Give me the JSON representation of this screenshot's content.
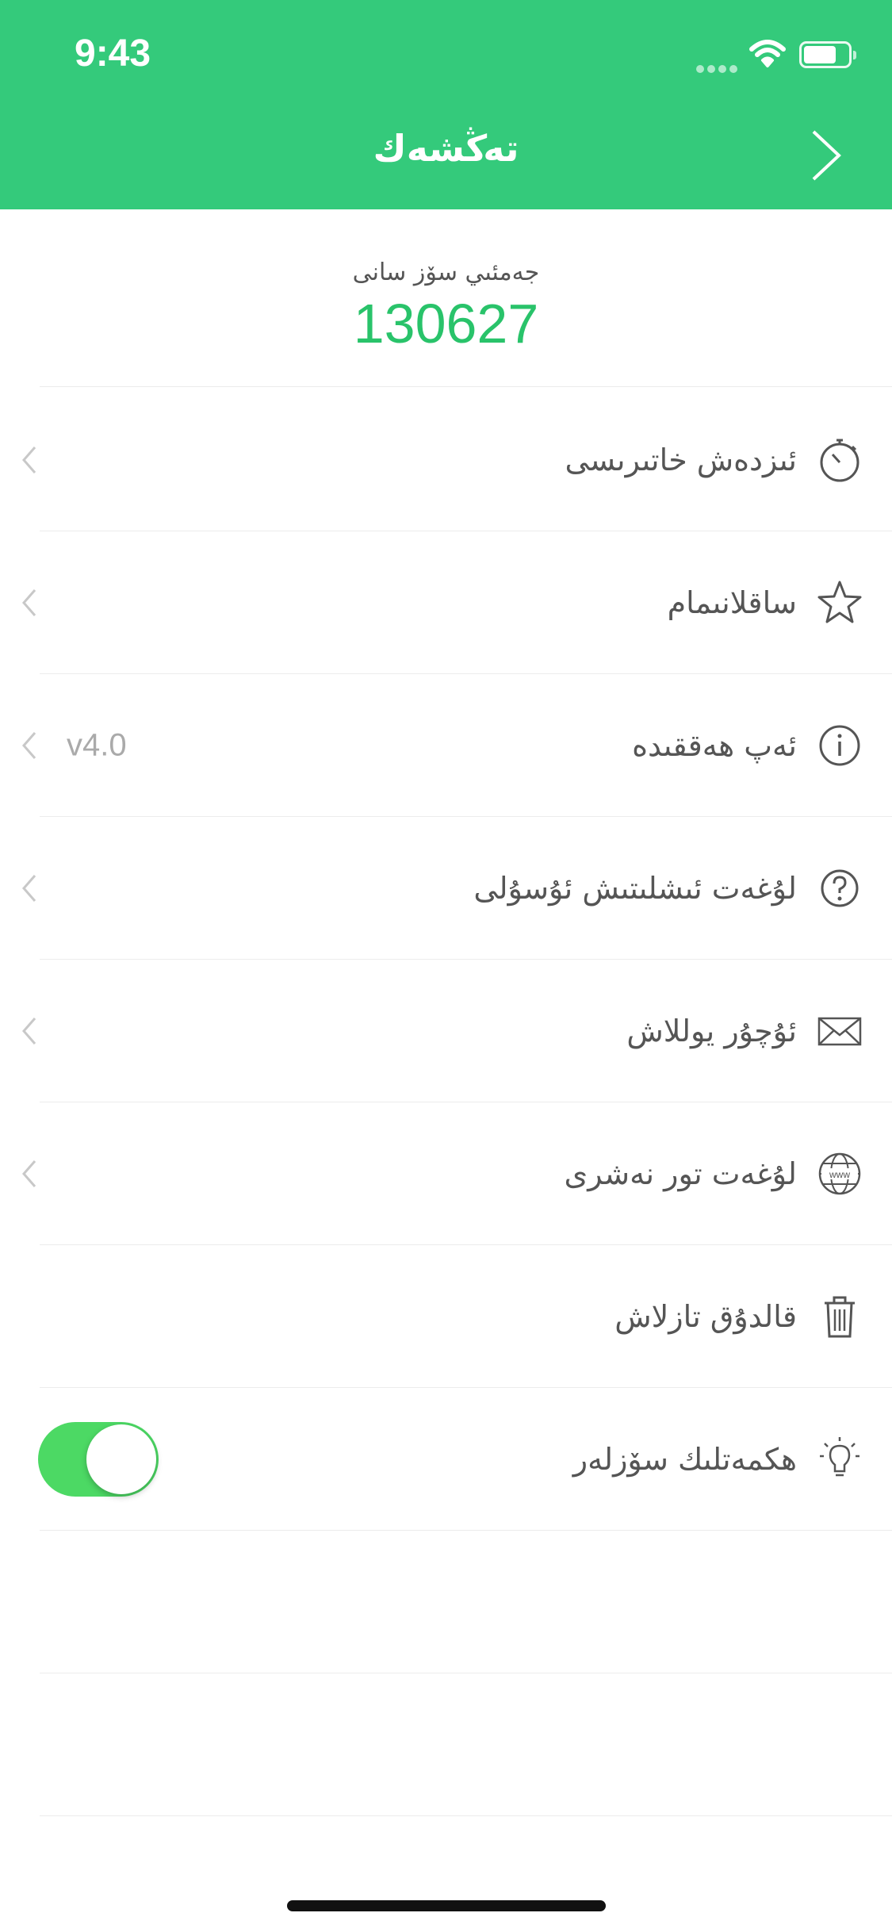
{
  "status_bar": {
    "time": "9:43"
  },
  "header": {
    "title": "تەڭشەك"
  },
  "total": {
    "label": "جەمئىي سۆز سانى",
    "value": "130627"
  },
  "menu": [
    {
      "label": "ئىزدەش خاتىرىسى",
      "icon": "stopwatch-icon",
      "value": ""
    },
    {
      "label": "ساقلانىمام",
      "icon": "star-icon",
      "value": ""
    },
    {
      "label": "ئەپ ھەققىدە",
      "icon": "info-icon",
      "value": "v4.0"
    },
    {
      "label": "لۇغەت ئىشلىتىش ئۇسۇلى",
      "icon": "help-icon",
      "value": ""
    },
    {
      "label": "ئۇچۇر يوللاش",
      "icon": "mail-icon",
      "value": ""
    },
    {
      "label": "لۇغەت تور نەشرى",
      "icon": "globe-icon",
      "value": ""
    },
    {
      "label": "قالدۇق تازلاش",
      "icon": "trash-icon",
      "value": ""
    },
    {
      "label": "ھكمەتلىك سۆزلەر",
      "icon": "lightbulb-icon",
      "value": "",
      "toggle_on": true
    }
  ],
  "colors": {
    "header_bg": "#34ca7b",
    "accent": "#29c36a",
    "toggle_on": "#4cd964"
  }
}
